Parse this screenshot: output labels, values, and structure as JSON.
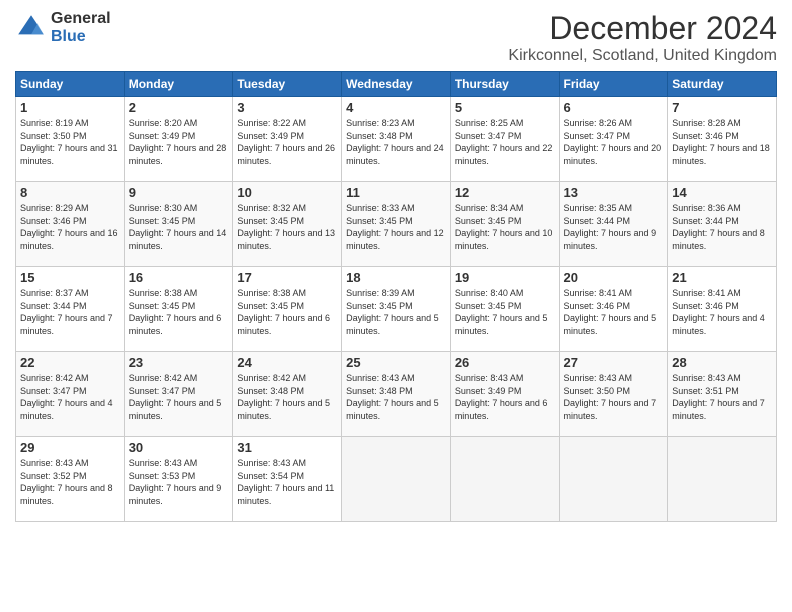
{
  "header": {
    "logo_general": "General",
    "logo_blue": "Blue",
    "title": "December 2024",
    "location": "Kirkconnel, Scotland, United Kingdom"
  },
  "days_of_week": [
    "Sunday",
    "Monday",
    "Tuesday",
    "Wednesday",
    "Thursday",
    "Friday",
    "Saturday"
  ],
  "weeks": [
    [
      {
        "day": "1",
        "sunrise": "Sunrise: 8:19 AM",
        "sunset": "Sunset: 3:50 PM",
        "daylight": "Daylight: 7 hours and 31 minutes."
      },
      {
        "day": "2",
        "sunrise": "Sunrise: 8:20 AM",
        "sunset": "Sunset: 3:49 PM",
        "daylight": "Daylight: 7 hours and 28 minutes."
      },
      {
        "day": "3",
        "sunrise": "Sunrise: 8:22 AM",
        "sunset": "Sunset: 3:49 PM",
        "daylight": "Daylight: 7 hours and 26 minutes."
      },
      {
        "day": "4",
        "sunrise": "Sunrise: 8:23 AM",
        "sunset": "Sunset: 3:48 PM",
        "daylight": "Daylight: 7 hours and 24 minutes."
      },
      {
        "day": "5",
        "sunrise": "Sunrise: 8:25 AM",
        "sunset": "Sunset: 3:47 PM",
        "daylight": "Daylight: 7 hours and 22 minutes."
      },
      {
        "day": "6",
        "sunrise": "Sunrise: 8:26 AM",
        "sunset": "Sunset: 3:47 PM",
        "daylight": "Daylight: 7 hours and 20 minutes."
      },
      {
        "day": "7",
        "sunrise": "Sunrise: 8:28 AM",
        "sunset": "Sunset: 3:46 PM",
        "daylight": "Daylight: 7 hours and 18 minutes."
      }
    ],
    [
      {
        "day": "8",
        "sunrise": "Sunrise: 8:29 AM",
        "sunset": "Sunset: 3:46 PM",
        "daylight": "Daylight: 7 hours and 16 minutes."
      },
      {
        "day": "9",
        "sunrise": "Sunrise: 8:30 AM",
        "sunset": "Sunset: 3:45 PM",
        "daylight": "Daylight: 7 hours and 14 minutes."
      },
      {
        "day": "10",
        "sunrise": "Sunrise: 8:32 AM",
        "sunset": "Sunset: 3:45 PM",
        "daylight": "Daylight: 7 hours and 13 minutes."
      },
      {
        "day": "11",
        "sunrise": "Sunrise: 8:33 AM",
        "sunset": "Sunset: 3:45 PM",
        "daylight": "Daylight: 7 hours and 12 minutes."
      },
      {
        "day": "12",
        "sunrise": "Sunrise: 8:34 AM",
        "sunset": "Sunset: 3:45 PM",
        "daylight": "Daylight: 7 hours and 10 minutes."
      },
      {
        "day": "13",
        "sunrise": "Sunrise: 8:35 AM",
        "sunset": "Sunset: 3:44 PM",
        "daylight": "Daylight: 7 hours and 9 minutes."
      },
      {
        "day": "14",
        "sunrise": "Sunrise: 8:36 AM",
        "sunset": "Sunset: 3:44 PM",
        "daylight": "Daylight: 7 hours and 8 minutes."
      }
    ],
    [
      {
        "day": "15",
        "sunrise": "Sunrise: 8:37 AM",
        "sunset": "Sunset: 3:44 PM",
        "daylight": "Daylight: 7 hours and 7 minutes."
      },
      {
        "day": "16",
        "sunrise": "Sunrise: 8:38 AM",
        "sunset": "Sunset: 3:45 PM",
        "daylight": "Daylight: 7 hours and 6 minutes."
      },
      {
        "day": "17",
        "sunrise": "Sunrise: 8:38 AM",
        "sunset": "Sunset: 3:45 PM",
        "daylight": "Daylight: 7 hours and 6 minutes."
      },
      {
        "day": "18",
        "sunrise": "Sunrise: 8:39 AM",
        "sunset": "Sunset: 3:45 PM",
        "daylight": "Daylight: 7 hours and 5 minutes."
      },
      {
        "day": "19",
        "sunrise": "Sunrise: 8:40 AM",
        "sunset": "Sunset: 3:45 PM",
        "daylight": "Daylight: 7 hours and 5 minutes."
      },
      {
        "day": "20",
        "sunrise": "Sunrise: 8:41 AM",
        "sunset": "Sunset: 3:46 PM",
        "daylight": "Daylight: 7 hours and 5 minutes."
      },
      {
        "day": "21",
        "sunrise": "Sunrise: 8:41 AM",
        "sunset": "Sunset: 3:46 PM",
        "daylight": "Daylight: 7 hours and 4 minutes."
      }
    ],
    [
      {
        "day": "22",
        "sunrise": "Sunrise: 8:42 AM",
        "sunset": "Sunset: 3:47 PM",
        "daylight": "Daylight: 7 hours and 4 minutes."
      },
      {
        "day": "23",
        "sunrise": "Sunrise: 8:42 AM",
        "sunset": "Sunset: 3:47 PM",
        "daylight": "Daylight: 7 hours and 5 minutes."
      },
      {
        "day": "24",
        "sunrise": "Sunrise: 8:42 AM",
        "sunset": "Sunset: 3:48 PM",
        "daylight": "Daylight: 7 hours and 5 minutes."
      },
      {
        "day": "25",
        "sunrise": "Sunrise: 8:43 AM",
        "sunset": "Sunset: 3:48 PM",
        "daylight": "Daylight: 7 hours and 5 minutes."
      },
      {
        "day": "26",
        "sunrise": "Sunrise: 8:43 AM",
        "sunset": "Sunset: 3:49 PM",
        "daylight": "Daylight: 7 hours and 6 minutes."
      },
      {
        "day": "27",
        "sunrise": "Sunrise: 8:43 AM",
        "sunset": "Sunset: 3:50 PM",
        "daylight": "Daylight: 7 hours and 7 minutes."
      },
      {
        "day": "28",
        "sunrise": "Sunrise: 8:43 AM",
        "sunset": "Sunset: 3:51 PM",
        "daylight": "Daylight: 7 hours and 7 minutes."
      }
    ],
    [
      {
        "day": "29",
        "sunrise": "Sunrise: 8:43 AM",
        "sunset": "Sunset: 3:52 PM",
        "daylight": "Daylight: 7 hours and 8 minutes."
      },
      {
        "day": "30",
        "sunrise": "Sunrise: 8:43 AM",
        "sunset": "Sunset: 3:53 PM",
        "daylight": "Daylight: 7 hours and 9 minutes."
      },
      {
        "day": "31",
        "sunrise": "Sunrise: 8:43 AM",
        "sunset": "Sunset: 3:54 PM",
        "daylight": "Daylight: 7 hours and 11 minutes."
      },
      null,
      null,
      null,
      null
    ]
  ]
}
